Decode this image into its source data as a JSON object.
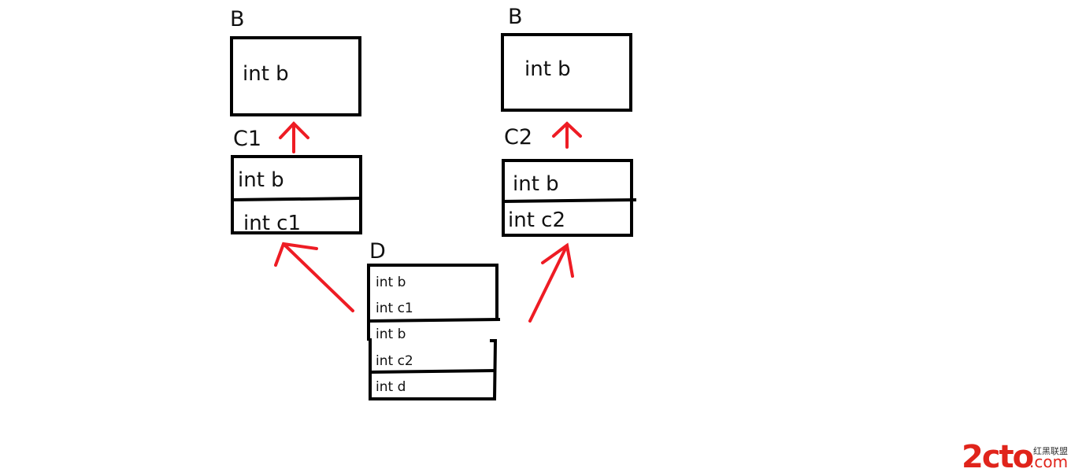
{
  "diagram": {
    "b_left": {
      "title": "B",
      "fields": [
        "int b"
      ]
    },
    "c1": {
      "title": "C1",
      "fields": [
        "int b",
        "int c1"
      ]
    },
    "b_right": {
      "title": "B",
      "fields": [
        "int b"
      ]
    },
    "c2": {
      "title": "C2",
      "fields": [
        "int b",
        "int c2"
      ]
    },
    "d": {
      "title": "D",
      "fields": [
        "int b",
        "int c1",
        "int b",
        "int c2",
        "int d"
      ]
    },
    "arrow_color": "#ee1c24"
  },
  "watermark": {
    "brand": "2cto",
    "suffix": ".com",
    "cn": "红黑联盟",
    "color": "#e0241b"
  }
}
